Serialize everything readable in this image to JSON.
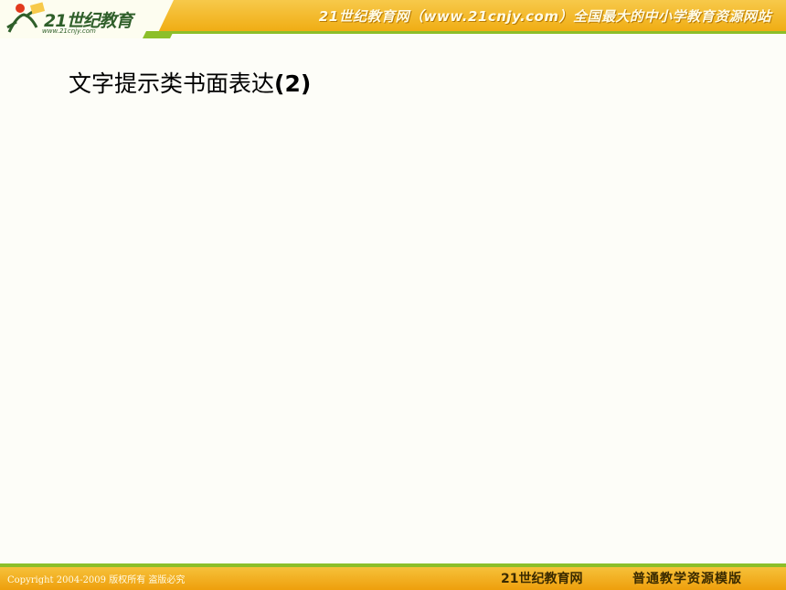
{
  "header": {
    "logo_text": "21世纪教育",
    "logo_url": "www.21cnjy.com",
    "slogan": "21世纪教育网（www.21cnjy.com）全国最大的中小学教育资源网站"
  },
  "slide": {
    "title_text": "文字提示类书面表达",
    "title_suffix": "(2)"
  },
  "footer": {
    "copyright": "Copyright 2004-2009 版权所有 盗版必究",
    "site_name": "21世纪教育网",
    "template_name": "普通教学资源模版"
  },
  "colors": {
    "header_orange": "#f0ad14",
    "accent_green": "#8cbf2a",
    "background": "#fdfdf8"
  }
}
